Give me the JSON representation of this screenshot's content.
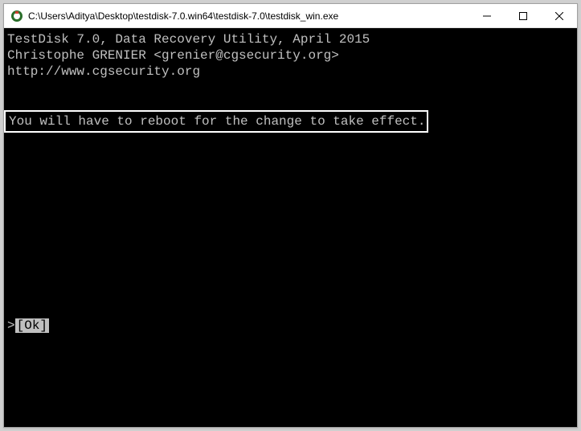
{
  "window": {
    "title": "C:\\Users\\Aditya\\Desktop\\testdisk-7.0.win64\\testdisk-7.0\\testdisk_win.exe"
  },
  "console": {
    "line1": "TestDisk 7.0, Data Recovery Utility, April 2015",
    "line2": "Christophe GRENIER <grenier@cgsecurity.org>",
    "line3": "http://www.cgsecurity.org",
    "message": "You will have to reboot for the change to take effect.",
    "prompt_prefix": ">",
    "ok_label": "[Ok]"
  }
}
